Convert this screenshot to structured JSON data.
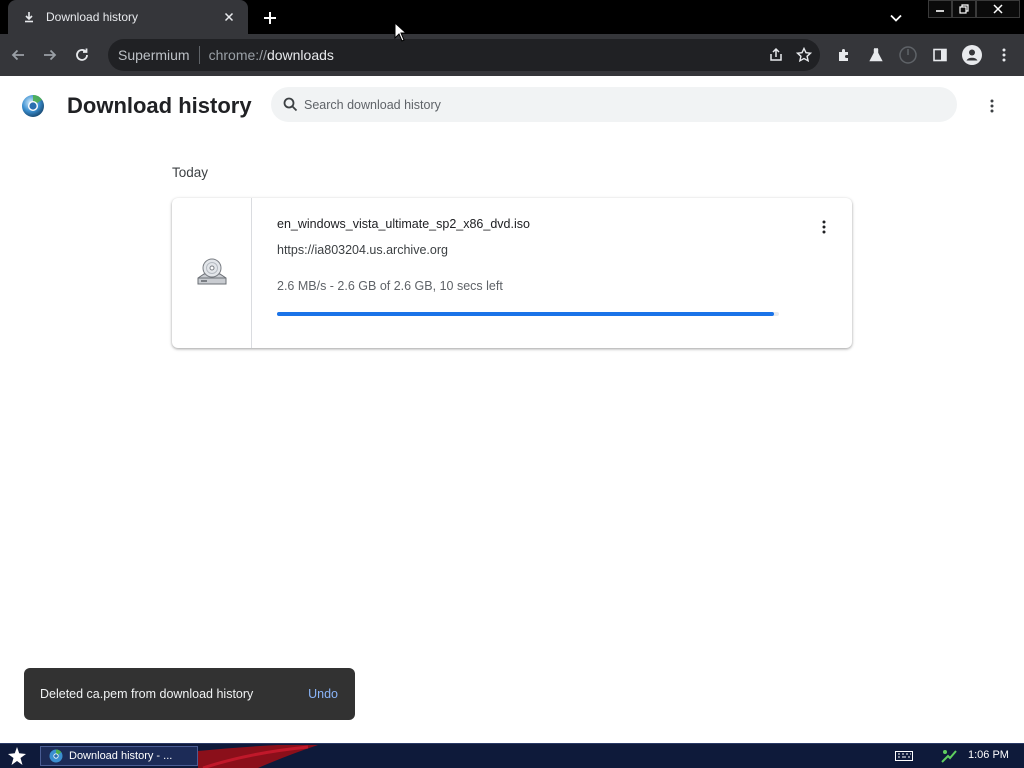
{
  "tab": {
    "title": "Download history",
    "icon": "download-icon"
  },
  "window": {
    "controls": [
      "minimize",
      "restore",
      "close"
    ]
  },
  "toolbar": {
    "site_label": "Supermium",
    "url_scheme": "chrome://",
    "url_host": "downloads",
    "omnibox_actions": [
      "share-icon",
      "bookmark-star-icon"
    ],
    "actions": [
      "extensions-icon",
      "labs-icon",
      "performance-icon",
      "side-panel-icon",
      "profile-icon",
      "browser-menu-icon"
    ]
  },
  "header": {
    "title": "Download history",
    "search_placeholder": "Search download history"
  },
  "downloads": {
    "section_label": "Today",
    "items": [
      {
        "file_name": "en_windows_vista_ultimate_sp2_x86_dvd.iso",
        "url": "https://ia803204.us.archive.org",
        "status": "2.6 MB/s - 2.6 GB of 2.6 GB, 10 secs left",
        "progress_percent": 99,
        "icon": "disc-drive-icon"
      }
    ]
  },
  "toast": {
    "message": "Deleted ca.pem from download history",
    "action": "Undo"
  },
  "taskbar": {
    "task_label": "Download history - ...",
    "clock": "1:06 PM"
  },
  "colors": {
    "accent": "#1a73e8",
    "toolbar_bg": "#35363a",
    "omnibox_bg": "#202124",
    "toast_bg": "#323232",
    "toast_action": "#8ab4f8",
    "taskbar_bg": "#0e1a3a"
  }
}
